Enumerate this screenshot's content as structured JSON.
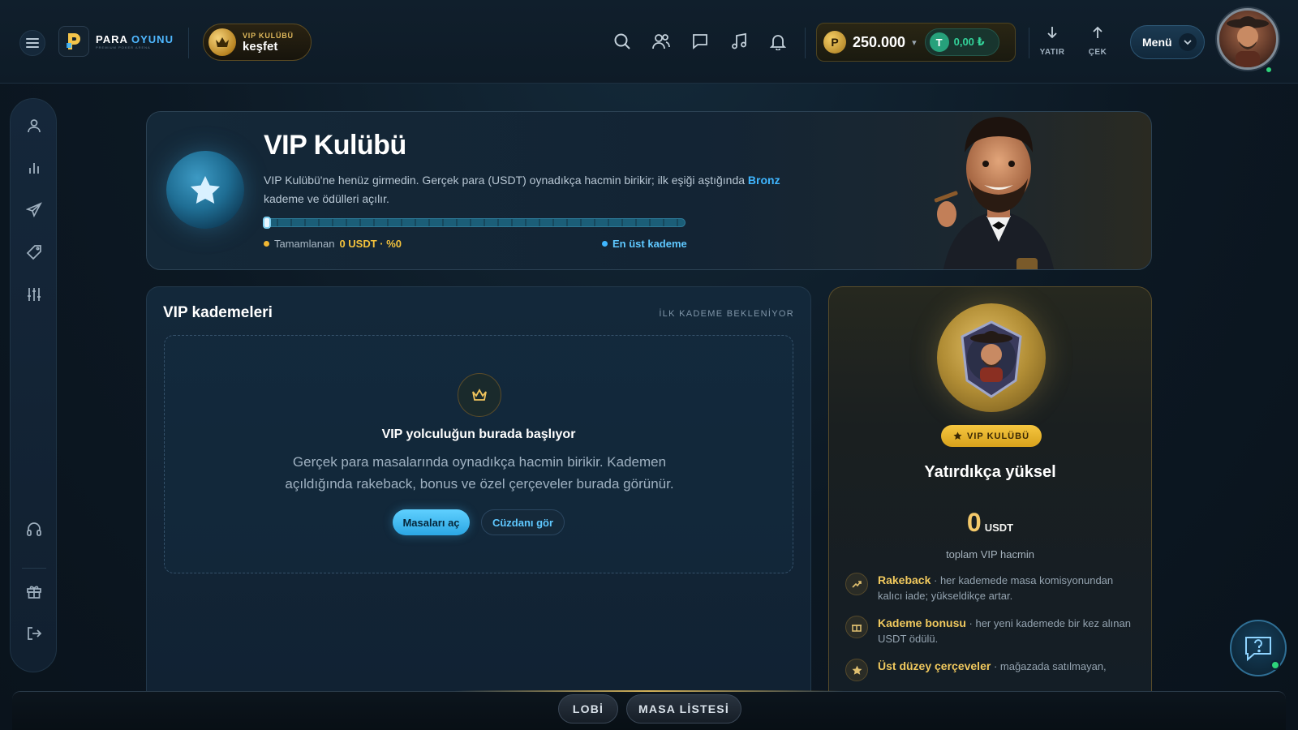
{
  "header": {
    "logo": {
      "word1": "PARA",
      "word2": "OYUNU",
      "tagline": "PREMIUM POKER ARENA"
    },
    "vip_pill": {
      "label": "VIP KULÜBÜ",
      "action": "keşfet"
    },
    "icons": [
      "search-icon",
      "friends-icon",
      "chat-icon",
      "music-icon",
      "bell-icon"
    ],
    "balance": {
      "value": "250.000",
      "usdt": "0,00 ₺"
    },
    "deposit_label": "YATIR",
    "withdraw_label": "ÇEK",
    "menu_label": "Menü"
  },
  "sidebar": {
    "items": [
      "profile-icon",
      "stats-icon",
      "send-icon",
      "tag-icon",
      "sliders-icon",
      "headset-icon",
      "gift-icon",
      "logout-icon"
    ]
  },
  "hero": {
    "title": "VIP Kulübü",
    "desc_part1": "VIP Kulübü'ne henüz girmedin. Gerçek para (USDT) oynadıkça hacmin birikir; ilk eşiği aştığında",
    "desc_highlight": "Bronz",
    "desc_part2": "kademe ve ödülleri açılır.",
    "progress_fraction": 0.0,
    "completed_label": "Tamamlanan",
    "completed_value": "0 USDT · %0",
    "top_tier_label": "En üst kademe"
  },
  "tiers": {
    "title": "VIP kademeleri",
    "status": "İLK KADEME BEKLENİYOR",
    "empty_title": "VIP yolculuğun burada başlıyor",
    "empty_text": "Gerçek para masalarında oynadıkça hacmin birikir. Kademen açıldığında rakeback, bonus ve özel çerçeveler burada görünür.",
    "primary_button": "Masaları aç",
    "secondary_button": "Cüzdanı gör"
  },
  "vip_card": {
    "badge": "VIP KULÜBÜ",
    "heading": "Yatırdıkça yüksel",
    "amount": "0",
    "unit": "USDT",
    "amount_caption": "toplam VIP hacmin",
    "perks": [
      {
        "name": "Rakeback",
        "text": "· her kademede masa komisyonundan kalıcı iade; yükseldikçe artar."
      },
      {
        "name": "Kademe bonusu",
        "text": "· her yeni kademede bir kez alınan USDT ödülü."
      },
      {
        "name": "Üst düzey çerçeveler",
        "text": "· mağazada satılmayan,"
      }
    ]
  },
  "bottom_tabs": {
    "lobby": "LOBİ",
    "table_list": "MASA LİSTESİ"
  },
  "colors": {
    "accent": "#3fb6ff",
    "gold": "#f4c23c",
    "online": "#2ed47a"
  }
}
